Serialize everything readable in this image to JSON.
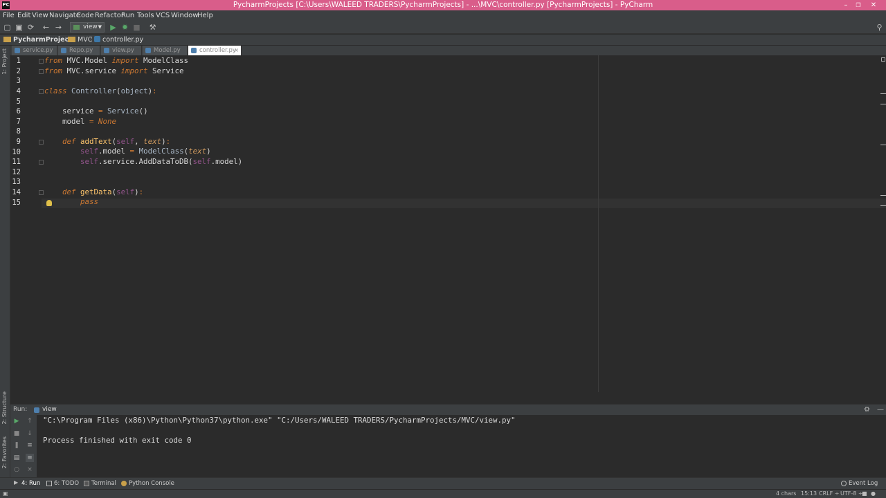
{
  "window": {
    "title": "PycharmProjects [C:\\Users\\WALEED TRADERS\\PycharmProjects] - ...\\MVC\\controller.py [PycharmProjects] - PyCharm",
    "app_icon": "PC",
    "controls": [
      "–",
      "❐",
      "✕"
    ]
  },
  "menu": [
    "File",
    "Edit",
    "View",
    "Navigate",
    "Code",
    "Refactor",
    "Run",
    "Tools",
    "VCS",
    "Window",
    "Help"
  ],
  "toolbar": {
    "run_config": "view",
    "icons": [
      "folder-open-icon",
      "save-icon",
      "sync-icon",
      "back-icon",
      "forward-icon",
      "run-icon",
      "debug-icon",
      "stop-icon",
      "settings-wrench-icon",
      "search-icon"
    ]
  },
  "breadcrumb": [
    "PycharmProjects",
    "MVC",
    "controller.py"
  ],
  "left_stripe": {
    "project": "1: Project",
    "structure": "2: Structure",
    "favorites": "2: Favorites"
  },
  "tabs": [
    {
      "label": "service.py",
      "active": false
    },
    {
      "label": "Repo.py",
      "active": false
    },
    {
      "label": "view.py",
      "active": false
    },
    {
      "label": "Model.py",
      "active": false
    },
    {
      "label": "controller.py",
      "active": true
    }
  ],
  "editor": {
    "line_numbers": [
      "1",
      "2",
      "3",
      "4",
      "5",
      "6",
      "7",
      "8",
      "9",
      "10",
      "11",
      "12",
      "13",
      "14",
      "15"
    ],
    "current_line": 15
  },
  "run_panel": {
    "label": "Run:",
    "tab": "view",
    "output_line1": "\"C:\\Program Files (x86)\\Python\\Python37\\python.exe\" \"C:/Users/WALEED TRADERS/PycharmProjects/MVC/view.py\"",
    "output_line2": "Process finished with exit code 0"
  },
  "bottom_tabs": [
    "4: Run",
    "6: TODO",
    "Terminal",
    "Python Console"
  ],
  "event_log": "Event Log",
  "status": {
    "chars": "4 chars",
    "position": "15:13",
    "line_sep": "CRLF ÷",
    "encoding": "UTF-8 ÷"
  }
}
